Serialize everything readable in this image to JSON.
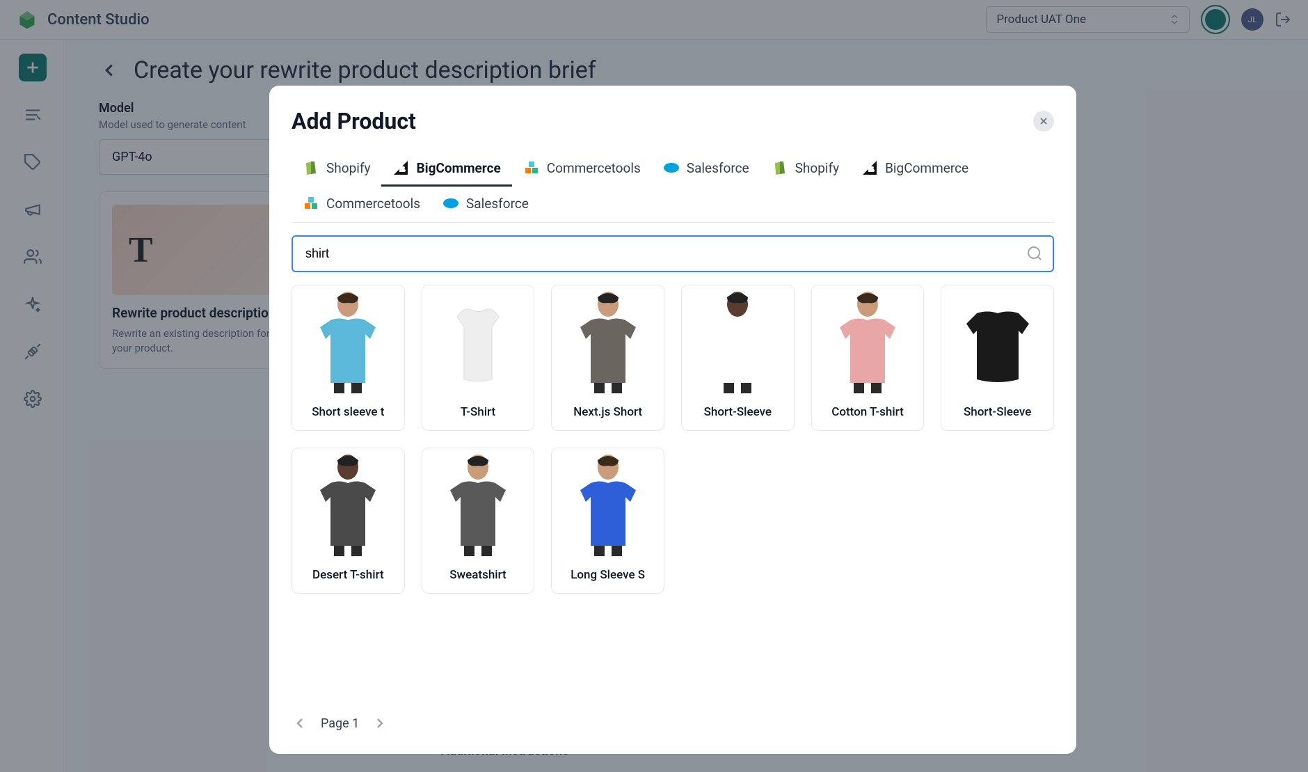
{
  "app": {
    "title": "Content Studio"
  },
  "header": {
    "dropdown_value": "Product UAT One",
    "avatar_initials": "JL"
  },
  "page": {
    "title": "Create your rewrite product description brief",
    "model_label": "Model",
    "model_sub": "Model used to generate content",
    "model_value": "GPT-4o",
    "card_title": "Rewrite product description",
    "card_desc": "Rewrite an existing description for your product.",
    "additional_label": "Additional Instructions"
  },
  "modal": {
    "title": "Add Product",
    "tabs": [
      {
        "label": "Shopify"
      },
      {
        "label": "BigCommerce",
        "active": true
      },
      {
        "label": "Commercetools"
      },
      {
        "label": "Salesforce"
      },
      {
        "label": "Shopify"
      },
      {
        "label": "BigCommerce"
      },
      {
        "label": "Commercetools"
      },
      {
        "label": "Salesforce"
      }
    ],
    "search_value": "shirt",
    "products": [
      {
        "name": "Short sleeve t"
      },
      {
        "name": "T-Shirt"
      },
      {
        "name": "Next.js Short"
      },
      {
        "name": "Short-Sleeve"
      },
      {
        "name": "Cotton T-shirt"
      },
      {
        "name": "Short-Sleeve"
      },
      {
        "name": "Desert T-shirt"
      },
      {
        "name": "Sweatshirt"
      },
      {
        "name": "Long Sleeve S"
      }
    ],
    "page_label": "Page 1"
  }
}
